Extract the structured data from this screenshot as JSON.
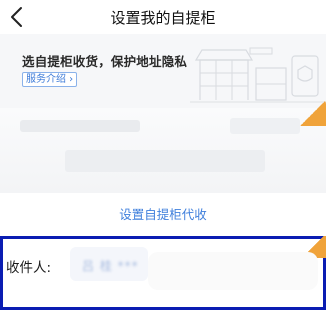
{
  "nav": {
    "title": "设置我的自提柜"
  },
  "banner": {
    "text": "选自提柜收货，保护地址隐私",
    "service_link": "服务介绍 ›"
  },
  "proxy": {
    "link": "设置自提柜代收"
  },
  "recipient": {
    "label": "收件人:",
    "value": "吕 桂 ***"
  }
}
